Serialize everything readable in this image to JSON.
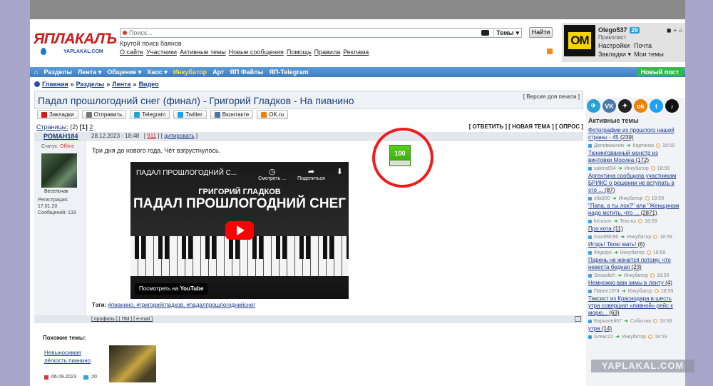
{
  "header": {
    "logo_main": "ЯПЛАКАЛЪ",
    "logo_sub": "YAPLAKAL.COM",
    "search_placeholder": "Поиск...",
    "search_scope": "Темы",
    "find_button": "Найти",
    "tagline": "Крутой поиск баянов",
    "links": [
      "О сайте",
      "Участники",
      "Активные темы",
      "Новые сообщения",
      "Помощь",
      "Правила",
      "Реклама"
    ]
  },
  "user": {
    "avatar_text": "OM",
    "name": "Olego537",
    "badge": "29",
    "rank": "Приколист",
    "links": [
      "Настройки",
      "Почта",
      "Закладки ▾",
      "Мои темы"
    ]
  },
  "nav": {
    "items": [
      "Разделы",
      "Лента ▾",
      "Общение ▾",
      "Хаос ▾",
      "Инкубатор",
      "Арт",
      "ЯП Файлы",
      "ЯП-Telegram"
    ],
    "new_post": "Новый пост"
  },
  "breadcrumb": [
    "Главная",
    "»",
    "Разделы",
    "»",
    "Лента",
    "»",
    "Видео"
  ],
  "topic": {
    "title": "Падал прошлогодний снег (финал) - Григорий Гладков - На пианино",
    "print_version": "[ Версия для печати ]",
    "share": [
      {
        "label": "Закладки",
        "color": "#d21a1a"
      },
      {
        "label": "Отправить",
        "color": "#777777"
      },
      {
        "label": "Telegram",
        "color": "#2aa0d8"
      },
      {
        "label": "Twitter",
        "color": "#1da1f2"
      },
      {
        "label": "Вконтакте",
        "color": "#4a76a8"
      },
      {
        "label": "OK.ru",
        "color": "#ee8208"
      }
    ],
    "pages_label": "Страницы:",
    "pages_count": "(2)",
    "page_current": "[1]",
    "page_next": "2",
    "actions": "[ ОТВЕТИТЬ ] [ НОВАЯ ТЕМА ] [ ОПРОС ]"
  },
  "post": {
    "author": "РОМАН184",
    "date": "28.12.2023 - 18:48",
    "post_number": "911",
    "quote_link": "цитировать",
    "status_label": "Статус:",
    "status_value": "Offline",
    "rank": "Весельчак",
    "registered": "Регистрация: 17.01.20",
    "messages": "Сообщений: 133",
    "text": "Три дня до нового года. Чёт взгрустнулось.",
    "rating": "100",
    "video": {
      "title": "ПАДАЛ ПРОШЛОГОДНИЙ С...",
      "watch_later": "Смотреть ...",
      "share": "Поделиться",
      "artist": "ГРИГОРИЙ ГЛАДКОВ",
      "song": "ПАДАЛ ПРОШЛОГОДНИЙ СНЕГ",
      "watch_on": "Посмотреть на",
      "platform": "YouTube"
    },
    "tags_label": "Тэги:",
    "tags": "#пианино, #григорийгладков, #падалпрошлогоднийснег",
    "footer": "[ профиль ] [ ПМ ] [ e-mail ]"
  },
  "similar": {
    "heading": "Похожие темы:",
    "title": "Невыносимая лёгкость пианино",
    "date": "06.09.2023",
    "comments": "20"
  },
  "sidebar": {
    "socials": [
      {
        "label": "✈",
        "color": "#2aa0d8"
      },
      {
        "label": "VK",
        "color": "#4a76a8"
      },
      {
        "label": "✦",
        "color": "#222222"
      },
      {
        "label": "ok",
        "color": "#ee8208"
      },
      {
        "label": "t",
        "color": "#1da1f2"
      },
      {
        "label": "♪",
        "color": "#111111"
      }
    ],
    "heading": "Активные темы",
    "items": [
      {
        "title": "Фотографии из прошлого нашей страны - 45",
        "count": "(239)",
        "user": "Деловианчик",
        "section": "Картинки",
        "time": "18:59"
      },
      {
        "title": "Тюнингованный монстр из винтовки Мосина",
        "count": "(172)",
        "user": "salera654",
        "section": "Инкубатор",
        "time": "18:59"
      },
      {
        "title": "Аргентина сообщила участникам БРИКС о решении не вступать в это ...",
        "count": "(87)",
        "user": "ella900",
        "section": "Инкубатор",
        "time": "18:59"
      },
      {
        "title": "\"Папа, а ты лох?\" или \"Женщинам надо мстить, что ...",
        "count": "(2871)",
        "user": "kerasov",
        "section": "Тексты",
        "time": "18:59"
      },
      {
        "title": "Про кота",
        "count": "(11)",
        "user": "max86fc96",
        "section": "Инкубатор",
        "time": "18:59"
      },
      {
        "title": "Игорь! Твою мать!",
        "count": "(6)",
        "user": "Федоро",
        "section": "Инкубатор",
        "time": "18:59"
      },
      {
        "title": "Парень не женится потому, что невеста бедная",
        "count": "(23)",
        "user": "Sevaslich",
        "section": "Инкубатор",
        "time": "18:59"
      },
      {
        "title": "Немножко вам зимы в ленту",
        "count": "(4)",
        "user": "Павел1974",
        "section": "Инкубатор",
        "time": "18:59"
      },
      {
        "title": "Таксист из Краснодара в шесть утра совершил «пивной» рейс к морю...",
        "count": "(63)",
        "user": "Баркалей67",
        "section": "События",
        "time": "18:59"
      },
      {
        "title": "утра",
        "count": "(14)",
        "user": "Алекс22",
        "section": "Инкубатор",
        "time": "18:59"
      }
    ]
  },
  "watermark": "YAPLAKAL.COM"
}
